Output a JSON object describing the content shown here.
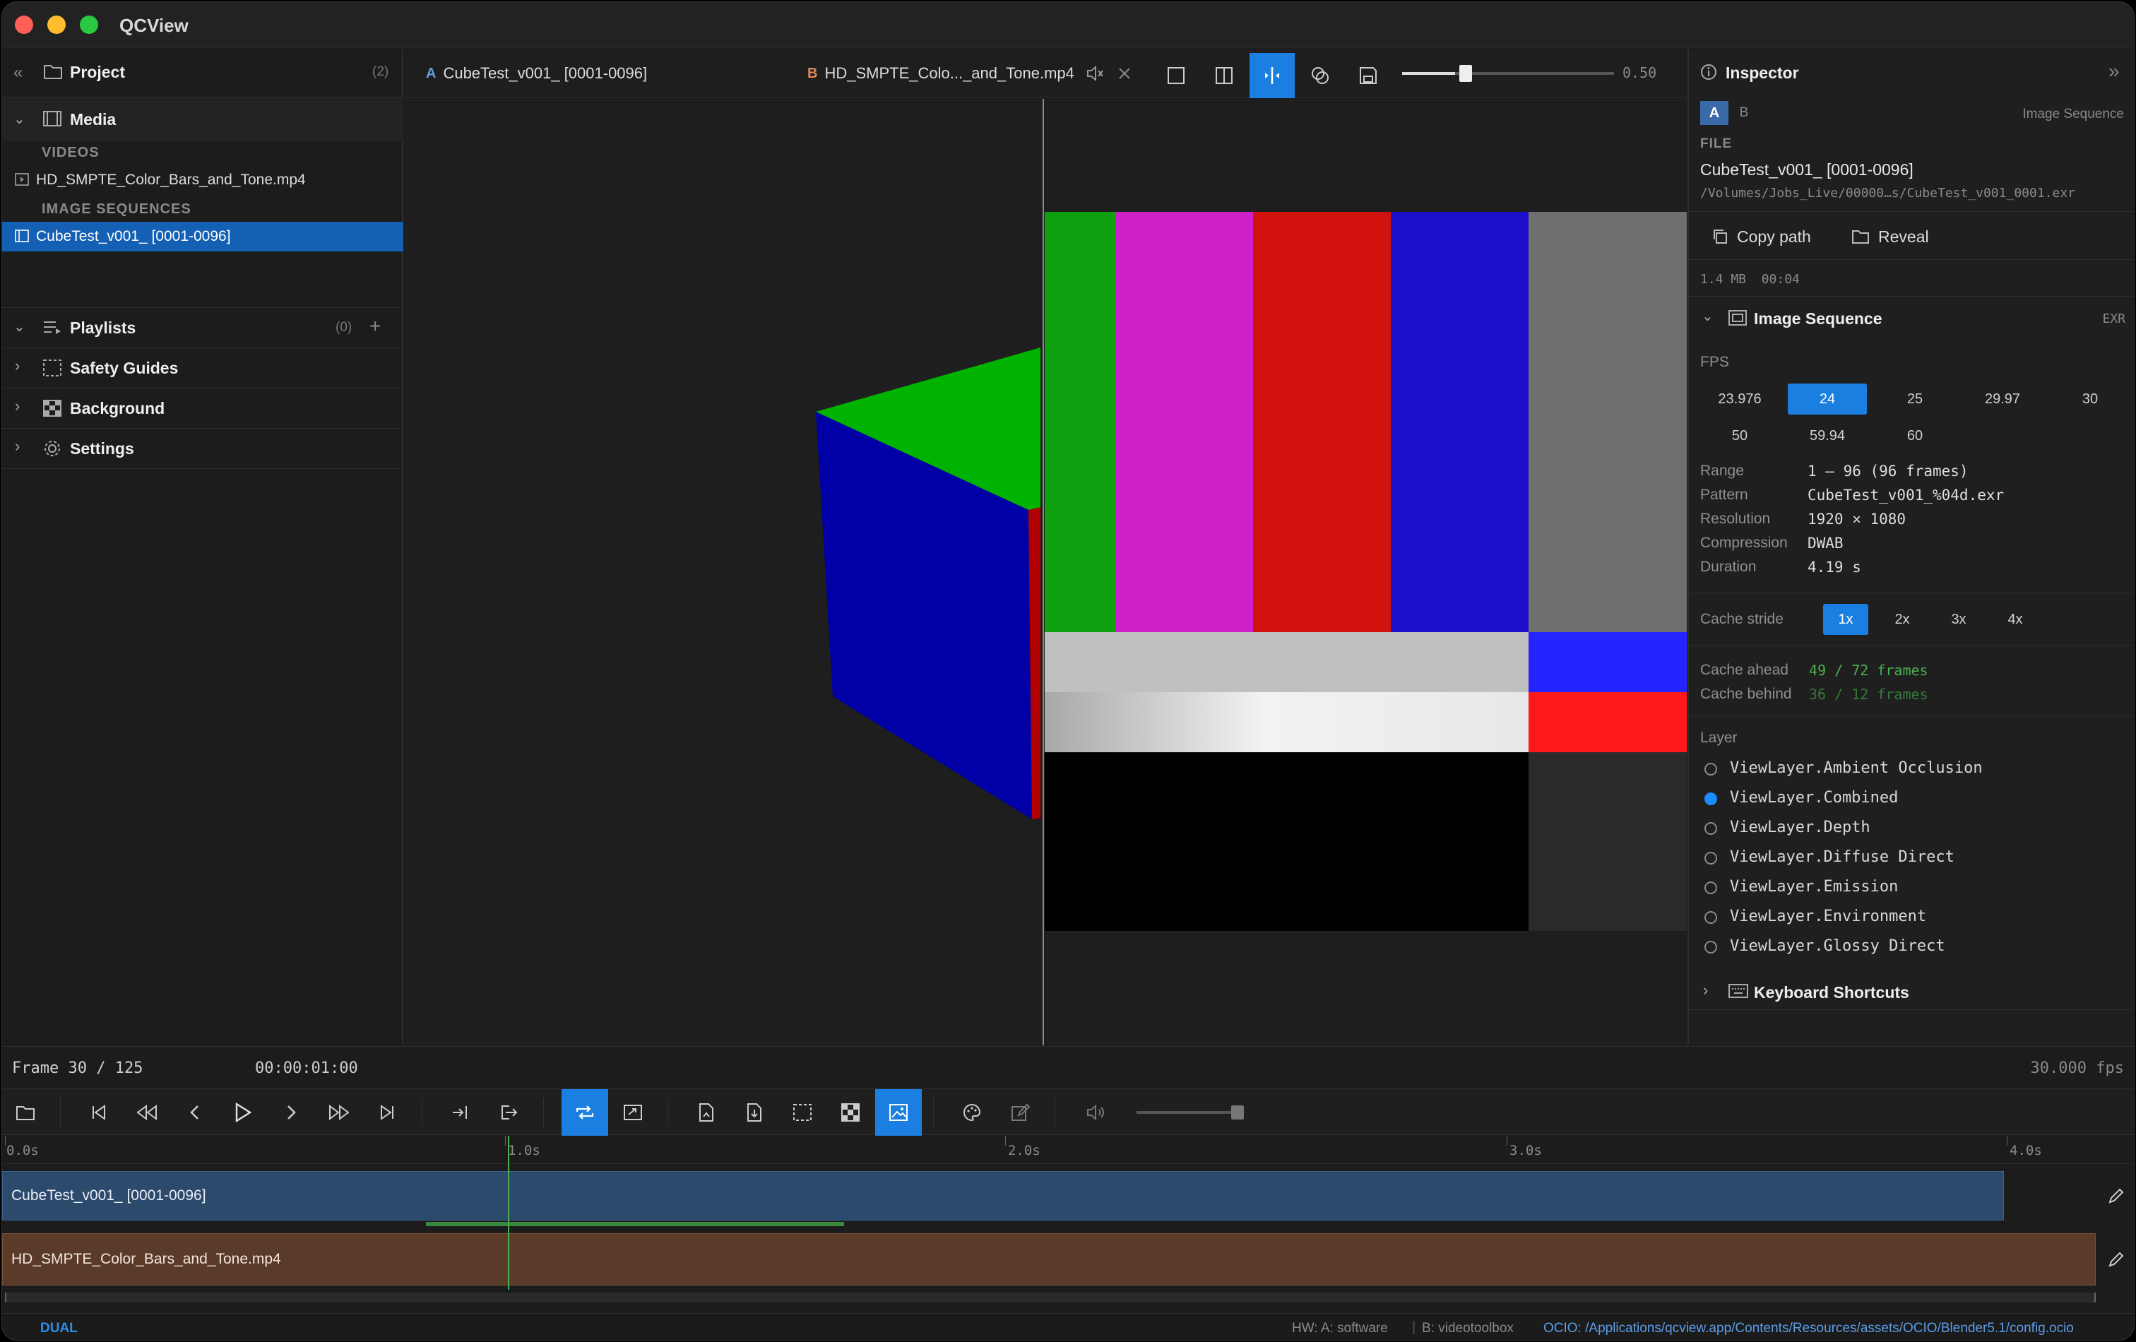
{
  "app": {
    "title": "QCView"
  },
  "sidebar": {
    "project": {
      "label": "Project",
      "count": "(2)"
    },
    "media": {
      "label": "Media"
    },
    "videos_header": "VIDEOS",
    "video_item": "HD_SMPTE_Color_Bars_and_Tone.mp4",
    "sequences_header": "IMAGE SEQUENCES",
    "sequence_item": "CubeTest_v001_ [0001-0096]",
    "playlists": {
      "label": "Playlists",
      "count": "(0)"
    },
    "safety_guides": "Safety Guides",
    "background": "Background",
    "settings": "Settings"
  },
  "tabs": {
    "a_letter": "A",
    "a_title": "CubeTest_v001_ [0001-0096]",
    "b_letter": "B",
    "b_title": "HD_SMPTE_Colo..._and_Tone.mp4",
    "opacity_value": "0.50",
    "opacity_fraction": 0.5
  },
  "inspector": {
    "title": "Inspector",
    "ab_a": "A",
    "ab_b": "B",
    "type": "Image Sequence",
    "file_label": "FILE",
    "file_name": "CubeTest_v001_ [0001-0096]",
    "file_path": "/Volumes/Jobs_Live/00000…s/CubeTest_v001_0001.exr",
    "copy_path": "Copy path",
    "reveal": "Reveal",
    "meta": "1.4 MB  00:04",
    "section_title": "Image Sequence",
    "section_badge": "EXR",
    "fps_label": "FPS",
    "fps_options": [
      "23.976",
      "24",
      "25",
      "29.97",
      "30",
      "50",
      "59.94",
      "60"
    ],
    "fps_selected": "24",
    "props": [
      {
        "label": "Range",
        "value": "1 – 96 (96 frames)"
      },
      {
        "label": "Pattern",
        "value": "CubeTest_v001_%04d.exr"
      },
      {
        "label": "Resolution",
        "value": "1920 × 1080"
      },
      {
        "label": "Compression",
        "value": "DWAB"
      },
      {
        "label": "Duration",
        "value": "4.19 s"
      }
    ],
    "cache_stride_label": "Cache stride",
    "cache_stride_options": [
      "1x",
      "2x",
      "3x",
      "4x"
    ],
    "cache_stride_selected": "1x",
    "cache_ahead_label": "Cache ahead",
    "cache_ahead_value": "49 / 72 frames",
    "cache_behind_label": "Cache behind",
    "cache_behind_value": "36 / 12 frames",
    "layer_label": "Layer",
    "layers": [
      "ViewLayer.Ambient Occlusion",
      "ViewLayer.Combined",
      "ViewLayer.Depth",
      "ViewLayer.Diffuse Direct",
      "ViewLayer.Emission",
      "ViewLayer.Environment",
      "ViewLayer.Glossy Direct"
    ],
    "layer_selected": "ViewLayer.Combined",
    "keyboard_shortcuts": "Keyboard Shortcuts"
  },
  "transport": {
    "frame": "Frame 30 / 125",
    "timecode": "00:00:01:00",
    "fps": "30.000 fps"
  },
  "timeline": {
    "ticks": [
      "0.0s",
      "1.0s",
      "2.0s",
      "3.0s",
      "4.0s"
    ],
    "track_a": "CubeTest_v001_ [0001-0096]",
    "track_b": "HD_SMPTE_Color_Bars_and_Tone.mp4"
  },
  "status": {
    "mode": "DUAL",
    "hw": "HW: A: software",
    "decoder": "B: videotoolbox",
    "ocio": "OCIO: /Applications/qcview.app/Contents/Resources/assets/OCIO/Blender5.1/config.ocio"
  },
  "colors": {
    "accent": "#1a7fe0",
    "track_a": "#2c4a6b",
    "track_b": "#5a3a28",
    "cache_green": "#4caf50",
    "arrow_red": "#e53935"
  }
}
